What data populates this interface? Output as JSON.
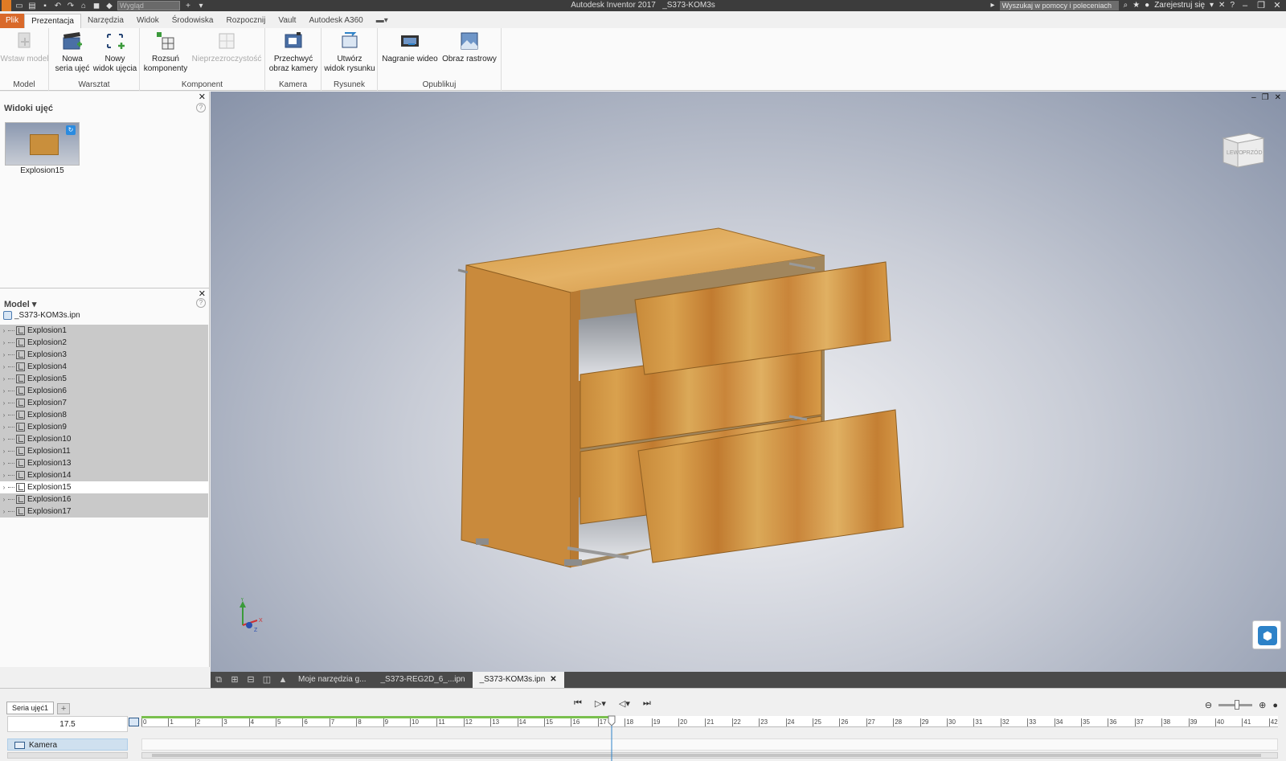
{
  "titlebar": {
    "app_title": "Autodesk Inventor 2017",
    "document_title": "_S373-KOM3s",
    "appearance_select": "Wygląd",
    "help_search_placeholder": "Wyszukaj w pomocy i poleceniach",
    "sign_in": "Zarejestruj się"
  },
  "menu_tabs": [
    "Plik",
    "Prezentacja",
    "Narzędzia",
    "Widok",
    "Środowiska",
    "Rozpocznij",
    "Vault",
    "Autodesk A360"
  ],
  "ribbon": {
    "groups": {
      "model": "Model",
      "workshop": "Warsztat",
      "component": "Komponent",
      "camera": "Kamera",
      "drawing": "Rysunek",
      "publish": "Opublikuj"
    },
    "buttons": {
      "insert_model": [
        "Wstaw model",
        ""
      ],
      "new_storyboard": [
        "Nowa",
        "seria ujęć"
      ],
      "new_snapshot": [
        "Nowy",
        "widok ujęcia"
      ],
      "tweak_components": [
        "Rozsuń",
        "komponenty"
      ],
      "opacity": [
        "Nieprzezroczystość",
        ""
      ],
      "capture_camera": [
        "Przechwyć",
        "obraz kamery"
      ],
      "create_drawing_view": [
        "Utwórz",
        "widok rysunku"
      ],
      "video": [
        "Nagranie wideo",
        ""
      ],
      "raster": [
        "Obraz rastrowy",
        ""
      ]
    }
  },
  "snapshot_panel": {
    "title": "Widoki ujęć",
    "thumbnail_label": "Explosion15"
  },
  "model_panel": {
    "title": "Model",
    "root": "_S373-KOM3s.ipn",
    "items": [
      "Explosion1",
      "Explosion2",
      "Explosion3",
      "Explosion4",
      "Explosion5",
      "Explosion6",
      "Explosion7",
      "Explosion8",
      "Explosion9",
      "Explosion10",
      "Explosion11",
      "Explosion13",
      "Explosion14",
      "Explosion15",
      "Explosion16",
      "Explosion17"
    ],
    "selected_index": 13
  },
  "viewport": {
    "viewcube_left": "LEWO",
    "viewcube_front": "PRZÓD",
    "triad_x": "X",
    "triad_y": "Y",
    "triad_z": "Z"
  },
  "doc_tabs": {
    "tools_tab": "Moje narzędzia g...",
    "file_tab_1": "_S373-REG2D_6_...ipn",
    "file_tab_2": "_S373-KOM3s.ipn"
  },
  "timeline": {
    "storyboard_tab": "Seria ujęć1",
    "current_time": "17.5",
    "track_label": "Kamera",
    "ruler_ticks": [
      "0",
      "1",
      "2",
      "3",
      "4",
      "5",
      "6",
      "7",
      "8",
      "9",
      "10",
      "11",
      "12",
      "13",
      "14",
      "15",
      "16",
      "17",
      "18",
      "19",
      "20",
      "21",
      "22",
      "23",
      "24",
      "25",
      "26",
      "27",
      "28",
      "29",
      "30",
      "31",
      "32",
      "33",
      "34",
      "35",
      "36",
      "37",
      "38",
      "39",
      "40",
      "41",
      "42"
    ]
  },
  "colors": {
    "file_tab": "#d9692a",
    "accent_blue": "#2d82c8",
    "selection_green": "#7ac04e"
  }
}
